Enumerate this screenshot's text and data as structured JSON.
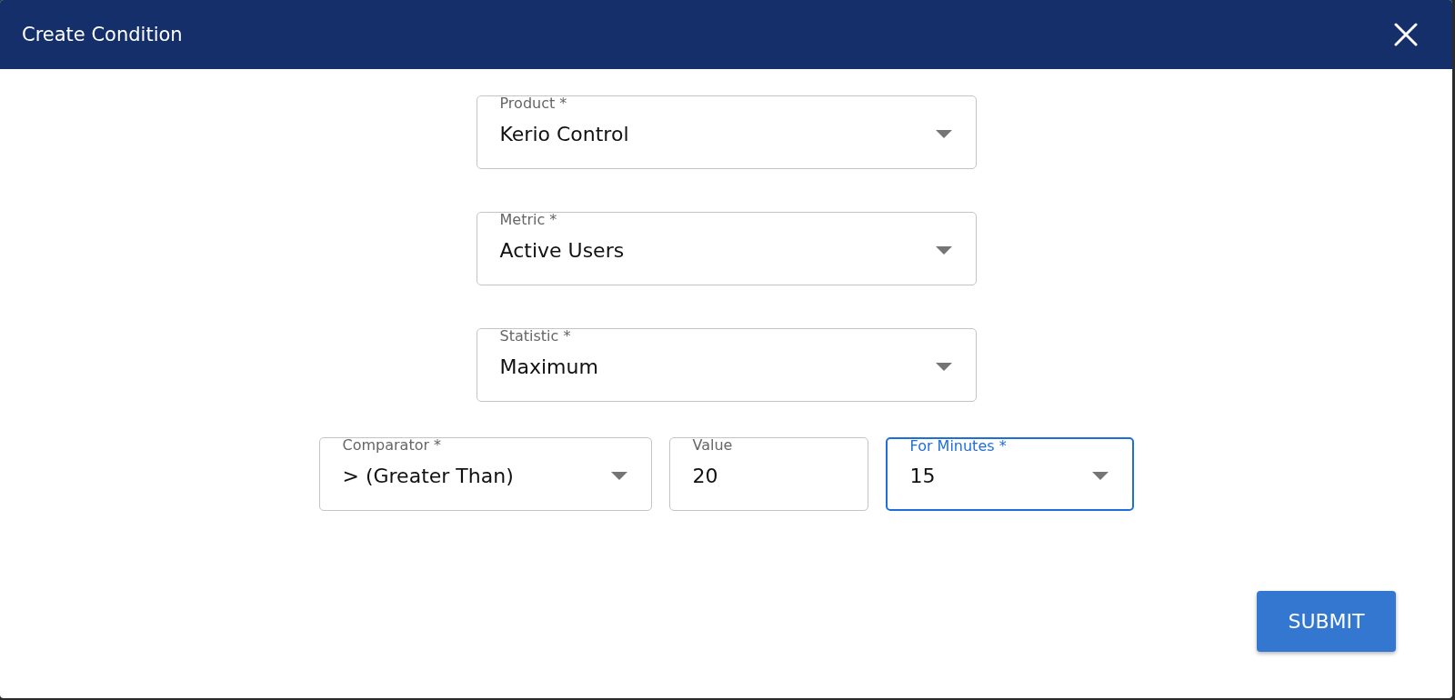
{
  "dialog": {
    "title": "Create Condition"
  },
  "fields": [
    {
      "kind": "select",
      "label": "Product *",
      "value": "Kerio Control",
      "focused": false
    },
    {
      "kind": "select",
      "label": "Metric *",
      "value": "Active Users",
      "focused": false
    },
    {
      "kind": "select",
      "label": "Statistic *",
      "value": "Maximum",
      "focused": false
    }
  ],
  "row": [
    {
      "kind": "select",
      "label": "Comparator *",
      "value": "> (Greater Than)",
      "focused": false
    },
    {
      "kind": "input",
      "label": "Value",
      "value": "20",
      "focused": false
    },
    {
      "kind": "select",
      "label": "For Minutes *",
      "value": "15",
      "focused": true
    }
  ],
  "submit": "SUBMIT"
}
